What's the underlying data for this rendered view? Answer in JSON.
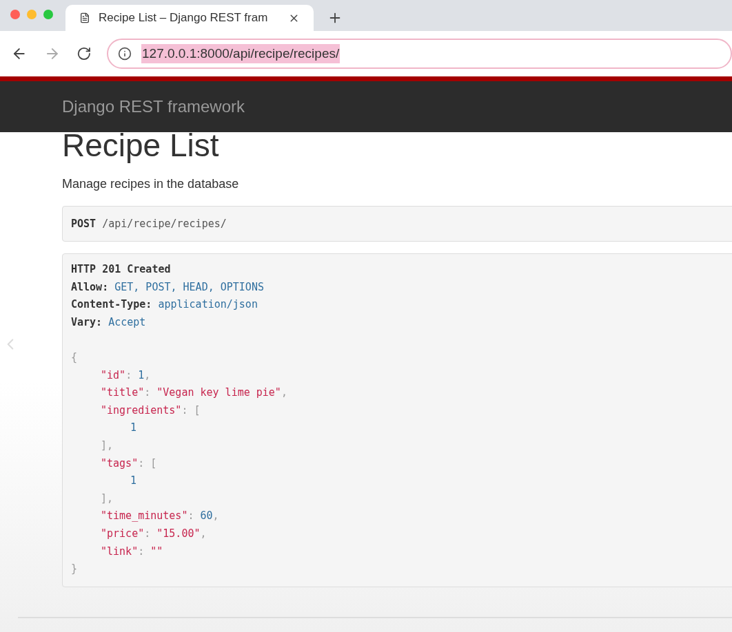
{
  "browser": {
    "tab": {
      "title": "Recipe List – Django REST fram",
      "selected": true
    },
    "address": {
      "url": "127.0.0.1:8000/api/recipe/recipes/",
      "selected": true
    }
  },
  "navbar": {
    "brand": "Django REST framework"
  },
  "page": {
    "title": "Recipe List",
    "description": "Manage recipes in the database"
  },
  "request": {
    "method": "POST",
    "path": "/api/recipe/recipes/"
  },
  "response": {
    "status": "HTTP 201 Created",
    "headers": [
      {
        "name": "Allow:",
        "value": "GET, POST, HEAD, OPTIONS"
      },
      {
        "name": "Content-Type:",
        "value": "application/json"
      },
      {
        "name": "Vary:",
        "value": "Accept"
      }
    ],
    "body": {
      "open": "{",
      "close": "}",
      "members": [
        {
          "key": "\"id\"",
          "sep": ":",
          "value": {
            "kind": "number",
            "text": "1"
          },
          "comma": ","
        },
        {
          "key": "\"title\"",
          "sep": ":",
          "value": {
            "kind": "string",
            "text": "\"Vegan key lime pie\""
          },
          "comma": ","
        },
        {
          "key": "\"ingredients\"",
          "sep": ":",
          "value": {
            "kind": "array",
            "open": "[",
            "close": "]",
            "children": [
              {
                "kind": "number",
                "text": "1"
              }
            ]
          },
          "comma": ","
        },
        {
          "key": "\"tags\"",
          "sep": ":",
          "value": {
            "kind": "array",
            "open": "[",
            "close": "]",
            "children": [
              {
                "kind": "number",
                "text": "1"
              }
            ]
          },
          "comma": ","
        },
        {
          "key": "\"time_minutes\"",
          "sep": ":",
          "value": {
            "kind": "number",
            "text": "60"
          },
          "comma": ","
        },
        {
          "key": "\"price\"",
          "sep": ":",
          "value": {
            "kind": "string",
            "text": "\"15.00\""
          },
          "comma": ","
        },
        {
          "key": "\"link\"",
          "sep": ":",
          "value": {
            "kind": "string",
            "text": "\"\""
          }
        }
      ]
    }
  }
}
